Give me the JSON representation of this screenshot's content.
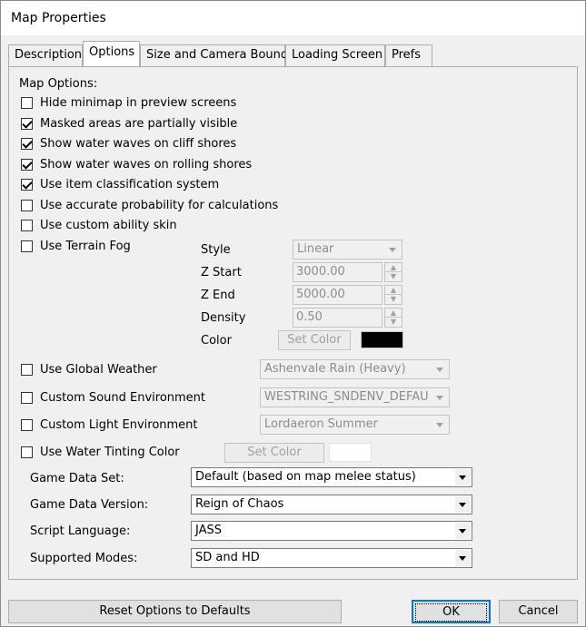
{
  "window": {
    "title": "Map Properties"
  },
  "tabs": [
    {
      "label": "Description"
    },
    {
      "label": "Options"
    },
    {
      "label": "Size and Camera Bounds"
    },
    {
      "label": "Loading Screen"
    },
    {
      "label": "Prefs"
    }
  ],
  "options": {
    "heading": "Map Options:",
    "checkboxes": [
      {
        "label": "Hide minimap in preview screens",
        "checked": false
      },
      {
        "label": "Masked areas are partially visible",
        "checked": true
      },
      {
        "label": "Show water waves on cliff shores",
        "checked": true
      },
      {
        "label": "Show water waves on rolling shores",
        "checked": true
      },
      {
        "label": "Use item classification system",
        "checked": true
      },
      {
        "label": "Use accurate probability for calculations",
        "checked": false
      },
      {
        "label": "Use custom ability skin",
        "checked": false
      },
      {
        "label": "Use Terrain Fog",
        "checked": false
      }
    ]
  },
  "fog": {
    "style_label": "Style",
    "style_value": "Linear",
    "zstart_label": "Z Start",
    "zstart_value": "3000.00",
    "zend_label": "Z End",
    "zend_value": "5000.00",
    "density_label": "Density",
    "density_value": "0.50",
    "color_label": "Color",
    "set_color_label": "Set Color",
    "color_swatch": "#000000"
  },
  "environment": {
    "global_weather_label": "Use Global Weather",
    "global_weather_value": "Ashenvale Rain (Heavy)",
    "sound_env_label": "Custom Sound Environment",
    "sound_env_value": "WESTRING_SNDENV_DEFAU",
    "light_env_label": "Custom Light Environment",
    "light_env_value": "Lordaeron Summer",
    "water_tint_label": "Use Water Tinting Color",
    "water_set_color_label": "Set Color",
    "water_swatch": "#ffffff"
  },
  "settings": {
    "game_data_set_label": "Game Data Set:",
    "game_data_set_value": "Default (based on map melee status)",
    "game_data_version_label": "Game Data Version:",
    "game_data_version_value": "Reign of Chaos",
    "script_language_label": "Script Language:",
    "script_language_value": "JASS",
    "supported_modes_label": "Supported Modes:",
    "supported_modes_value": "SD and HD"
  },
  "footer": {
    "reset_label": "Reset Options to Defaults",
    "ok_label": "OK",
    "cancel_label": "Cancel"
  }
}
